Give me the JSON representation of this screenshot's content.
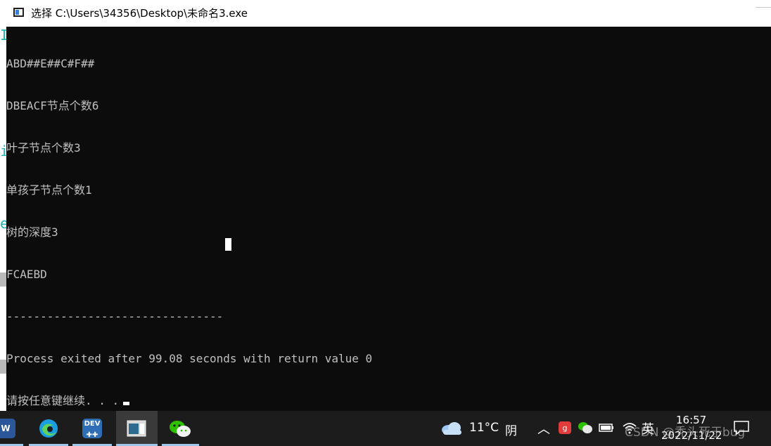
{
  "window": {
    "title": "选择 C:\\Users\\34356\\Desktop\\未命名3.exe"
  },
  "console": {
    "lines": [
      "ABD##E##C#F##",
      "DBEACF节点个数6",
      "叶子节点个数3",
      "单孩子节点个数1",
      "树的深度3",
      "FCAEBD",
      "--------------------------------",
      "Process exited after 99.08 seconds with return value 0",
      "请按任意键继续. . ."
    ]
  },
  "taskbar": {
    "apps": [
      {
        "name": "word",
        "label": "W",
        "color": "#2b579a"
      },
      {
        "name": "edge",
        "label": "",
        "color": "#1b9de2"
      },
      {
        "name": "devcpp",
        "label": "DEV",
        "color": "#2f6db5"
      },
      {
        "name": "console",
        "label": "",
        "color": "#8a8a8a"
      },
      {
        "name": "wechat",
        "label": "",
        "color": "#2dc100"
      }
    ],
    "weather": {
      "temperature": "11°C",
      "condition": "阴"
    },
    "ime": "英",
    "clock": {
      "time": "16:57",
      "date": "2022/11/22"
    },
    "watermark": "CSDN @秃头死于bug"
  },
  "colors": {
    "console_bg": "#0c0c0c",
    "console_text": "#c0c0c0",
    "taskbar_bg": "#1c1c1c",
    "accent": "#9ec7ea"
  }
}
